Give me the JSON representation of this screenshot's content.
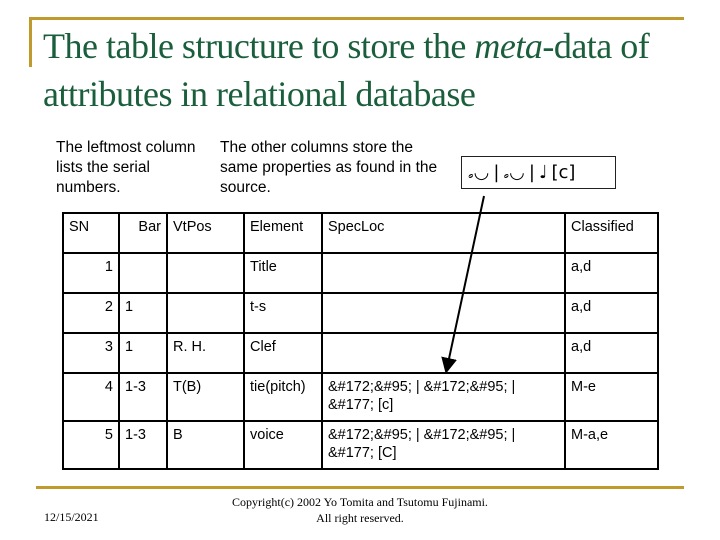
{
  "slide": {
    "title_part1": "The table structure to store the ",
    "title_italic": "meta",
    "title_part2": "-data of attributes in relational database",
    "note_left": "The leftmost column lists the serial numbers.",
    "note_right": "The other columns store the same properties as found in the source.",
    "music_example": {
      "symbols": [
        "𝅗◡",
        "|",
        "𝅗◡",
        "|",
        "♩",
        "[c]"
      ],
      "description": "tied notes | tied notes | quarter note [c]"
    },
    "accent_color": "#c09a2c",
    "title_color": "#1a5e3c"
  },
  "table": {
    "headers": [
      "SN",
      "Bar",
      "VtPos",
      "Element",
      "SpecLoc",
      "Classified"
    ],
    "rows": [
      [
        "1",
        "",
        "",
        "Title",
        "",
        "a,d"
      ],
      [
        "2",
        "1",
        "",
        "t-s",
        "",
        "a,d"
      ],
      [
        "3",
        "1",
        "R. H.",
        "Clef",
        "",
        "a,d"
      ],
      [
        "4",
        "1-3",
        "T(B)",
        "tie(pitch)",
        "&#172;&#95; | &#172;&#95; | &#177; [c]",
        "M-e"
      ],
      [
        "5",
        "1-3",
        "B",
        "voice",
        "&#172;&#95; | &#172;&#95; | &#177; [C]",
        "M-a,e"
      ]
    ]
  },
  "footer": {
    "date": "12/15/2021",
    "copyright": "Copyright(c) 2002 Yo Tomita and Tsutomu Fujinami. All right reserved."
  }
}
